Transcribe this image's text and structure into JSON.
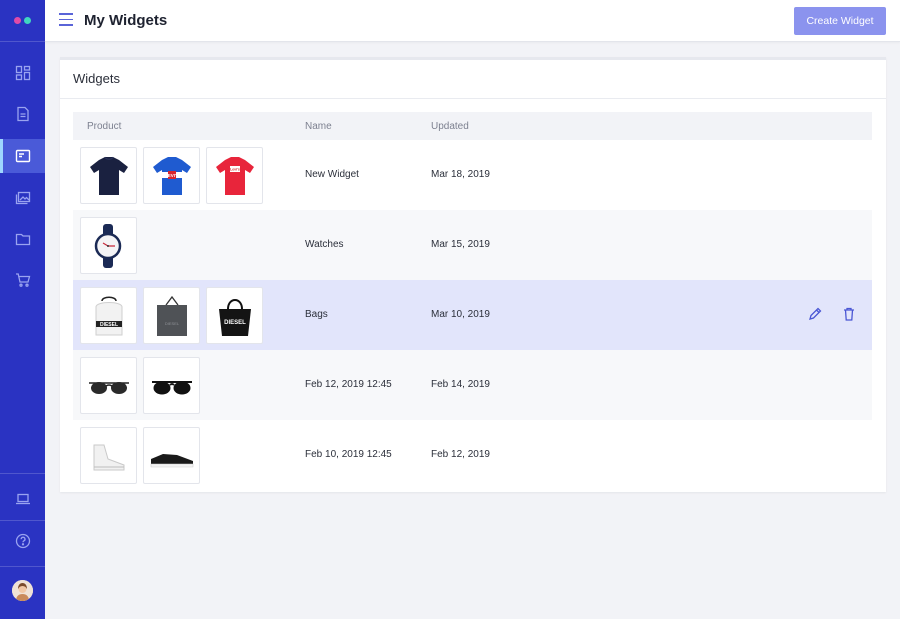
{
  "brand": {
    "accent": "#2a33c2",
    "dot_left": "#e04ba8",
    "dot_right": "#3fd6c0"
  },
  "header": {
    "title": "My Widgets",
    "create_label": "Create Widget"
  },
  "sidebar": {
    "items": [
      {
        "icon": "dashboard-icon"
      },
      {
        "icon": "document-icon"
      },
      {
        "icon": "widget-icon",
        "active": true
      },
      {
        "icon": "gallery-icon"
      },
      {
        "icon": "folder-icon"
      },
      {
        "icon": "cart-icon"
      }
    ],
    "bottom": [
      {
        "icon": "laptop-icon"
      },
      {
        "icon": "help-icon"
      }
    ]
  },
  "card": {
    "title": "Widgets"
  },
  "table": {
    "columns": [
      "Product",
      "Name",
      "Updated"
    ],
    "rows": [
      {
        "products": [
          "navy-tshirt",
          "blue-levis-tshirt",
          "red-levis-tshirt"
        ],
        "name": "New Widget",
        "updated": "Mar 18, 2019"
      },
      {
        "products": [
          "watch"
        ],
        "name": "Watches",
        "updated": "Mar 15, 2019"
      },
      {
        "products": [
          "white-diesel-backpack",
          "grey-diesel-tote",
          "black-diesel-bag"
        ],
        "name": "Bags",
        "updated": "Mar 10, 2019",
        "highlighted": true
      },
      {
        "products": [
          "sunglasses",
          "sunglasses-dark"
        ],
        "name": "Feb 12, 2019 12:45",
        "updated": "Feb 14, 2019"
      },
      {
        "products": [
          "white-hightop-sneaker",
          "black-sneaker"
        ],
        "name": "Feb 10, 2019 12:45",
        "updated": "Feb 12, 2019"
      }
    ],
    "row_actions": [
      "edit-icon",
      "delete-icon"
    ]
  },
  "product_labels": {
    "levis_1": "LEVI'S",
    "levis_2": "Levi's",
    "diesel_1": "DIESEL",
    "diesel_2": "DIESEL",
    "diesel_3": "DIESEL"
  }
}
